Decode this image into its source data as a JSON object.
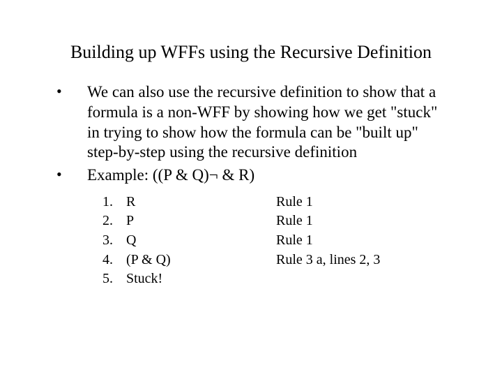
{
  "title": "Building up WFFs using the Recursive Definition",
  "bullets": [
    {
      "marker": "•",
      "text": "We can also use the recursive definition to show that a formula is a non-WFF by showing how we get \"stuck\" in trying to show how the formula can be \"built up\" step-by-step using the recursive definition"
    },
    {
      "marker": "•",
      "text": "Example: ((P & Q)¬ & R)"
    }
  ],
  "steps": [
    {
      "num": "1.",
      "formula": "R",
      "rule": "Rule 1"
    },
    {
      "num": "2.",
      "formula": "P",
      "rule": "Rule 1"
    },
    {
      "num": "3.",
      "formula": "Q",
      "rule": "Rule 1"
    },
    {
      "num": "4.",
      "formula": "(P & Q)",
      "rule": "Rule 3 a, lines 2, 3"
    },
    {
      "num": "5.",
      "formula": "Stuck!",
      "rule": ""
    }
  ]
}
